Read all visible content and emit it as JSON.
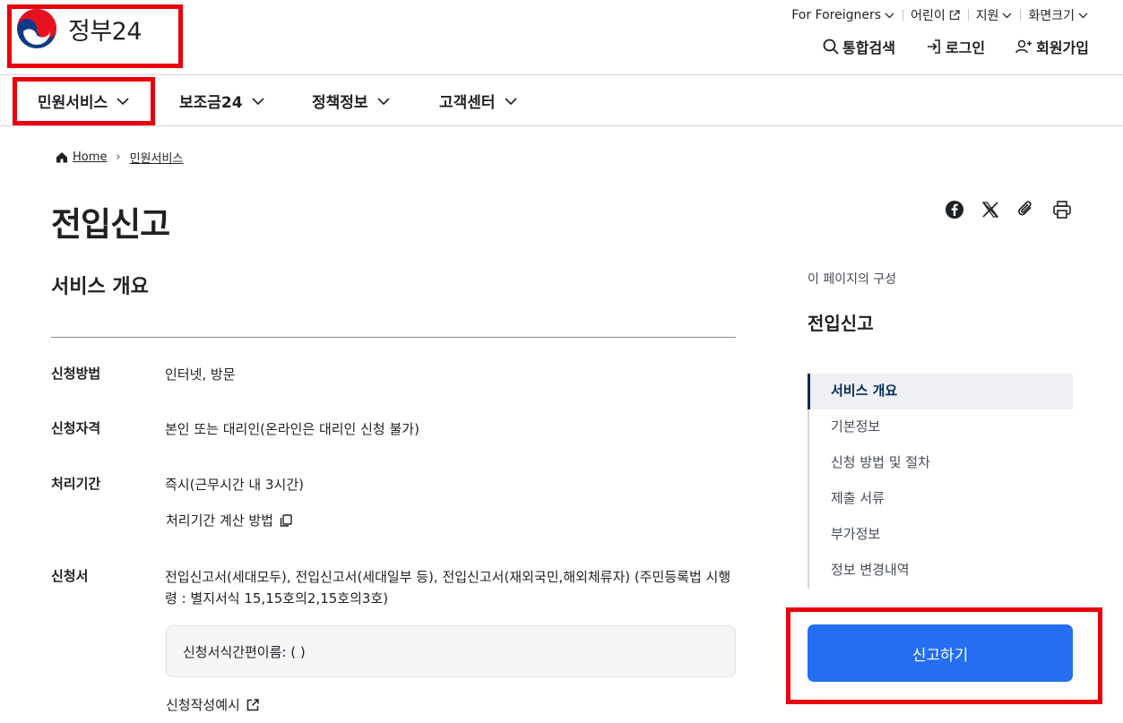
{
  "logo": {
    "text": "정부24"
  },
  "util_nav": [
    {
      "label": "For Foreigners",
      "icon": "chevron-down-icon"
    },
    {
      "label": "어린이",
      "icon": "external-link-icon"
    },
    {
      "label": "지원",
      "icon": "chevron-down-icon"
    },
    {
      "label": "화면크기",
      "icon": "chevron-down-icon"
    }
  ],
  "main_util": [
    {
      "label": "통합검색",
      "icon": "search-icon"
    },
    {
      "label": "로그인",
      "icon": "login-icon"
    },
    {
      "label": "회원가입",
      "icon": "user-add-icon"
    }
  ],
  "gnb": [
    {
      "label": "민원서비스"
    },
    {
      "label": "보조금24"
    },
    {
      "label": "정책정보"
    },
    {
      "label": "고객센터"
    }
  ],
  "breadcrumb": {
    "home": "Home",
    "current": "민원서비스"
  },
  "page": {
    "title": "전입신고",
    "section_title": "서비스 개요"
  },
  "info": {
    "method": {
      "label": "신청방법",
      "value": "인터넷, 방문"
    },
    "eligibility": {
      "label": "신청자격",
      "value": "본인 또는 대리인(온라인은 대리인 신청 불가)"
    },
    "period": {
      "label": "처리기간",
      "value": "즉시(근무시간 내 3시간)",
      "link": "처리기간 계산 방법"
    },
    "forms": {
      "label": "신청서",
      "value": "전입신고서(세대모두), 전입신고서(세대일부 등), 전입신고서(재외국민,해외체류자) (주민등록법 시행령 : 별지서식 15,15호의2,15호의3호)",
      "box_text": "신청서식간편이름: ( )",
      "example_link": "신청작성예시"
    }
  },
  "toc": {
    "caption": "이 페이지의 구성",
    "title": "전입신고",
    "items": [
      {
        "label": "서비스 개요"
      },
      {
        "label": "기본정보"
      },
      {
        "label": "신청 방법 및 절차"
      },
      {
        "label": "제출 서류"
      },
      {
        "label": "부가정보"
      },
      {
        "label": "정보 변경내역"
      }
    ]
  },
  "cta": {
    "label": "신고하기"
  },
  "colors": {
    "primary": "#256ef4",
    "highlight": "#e8000b",
    "navy": "#052b57"
  }
}
